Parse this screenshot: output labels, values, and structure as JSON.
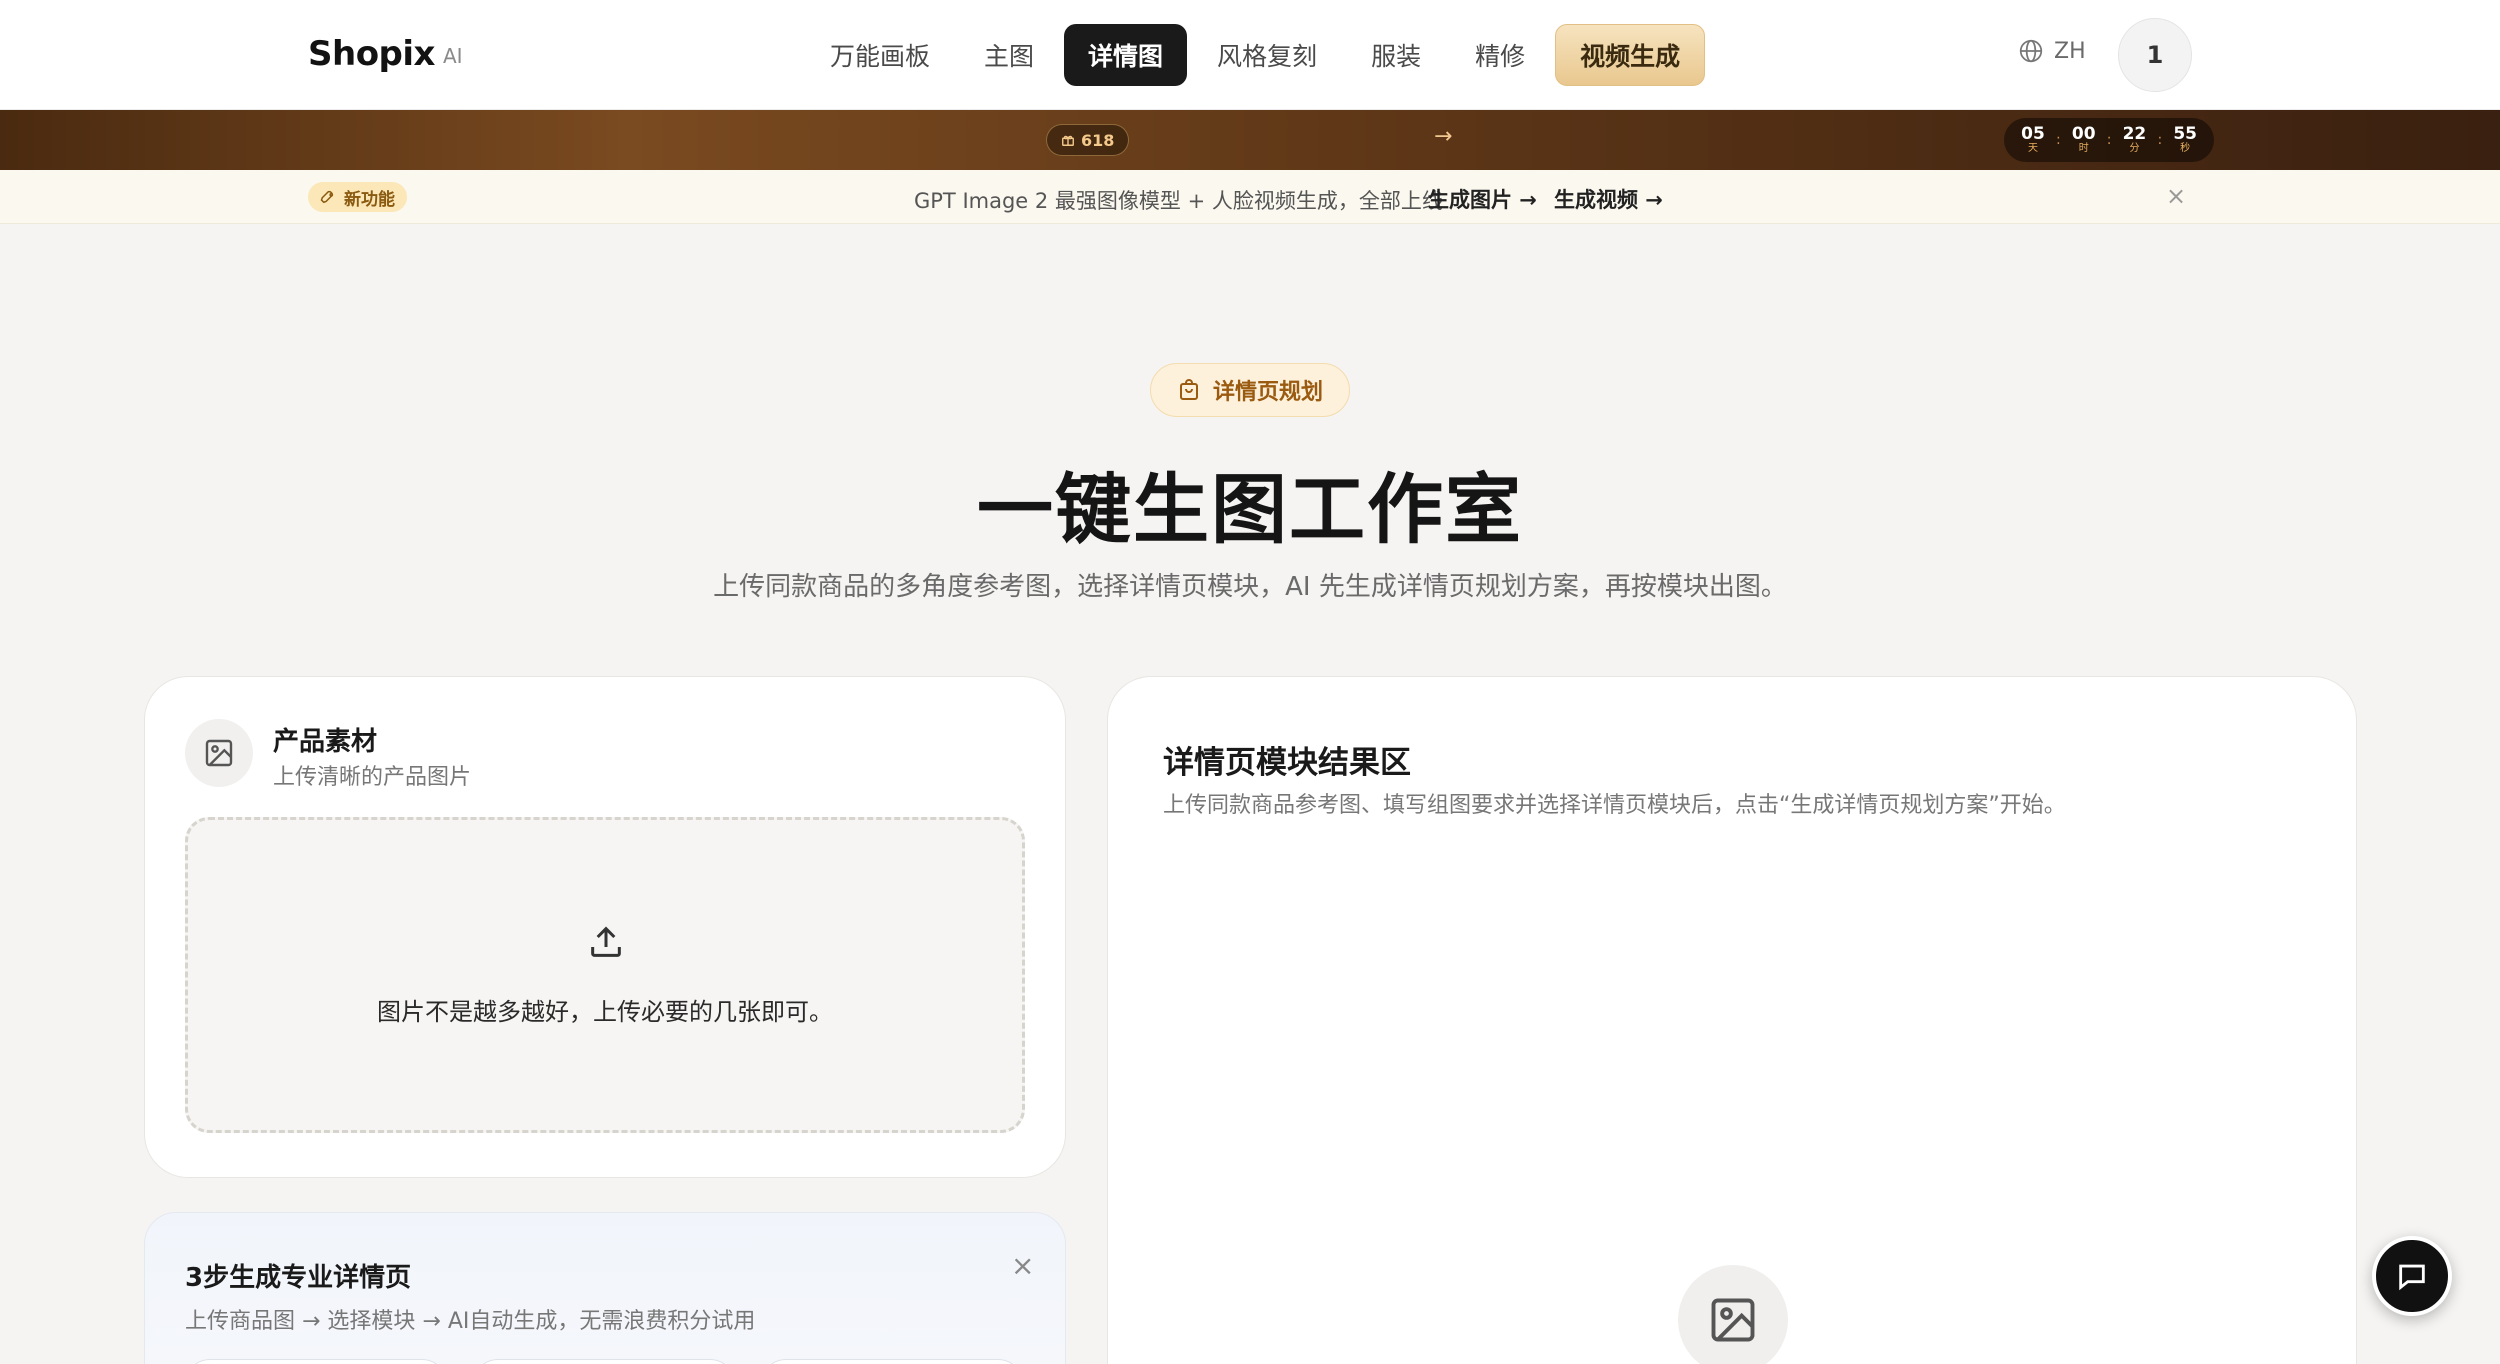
{
  "header": {
    "logo": "Shopix",
    "logo_suffix": "AI",
    "nav": [
      {
        "label": "万能画板"
      },
      {
        "label": "主图"
      },
      {
        "label": "详情图"
      },
      {
        "label": "风格复刻"
      },
      {
        "label": "服装"
      },
      {
        "label": "精修"
      },
      {
        "label": "视频生成"
      }
    ],
    "active_nav": "详情图",
    "language": "ZH",
    "avatar_text": "1"
  },
  "promo": {
    "badge": "618",
    "arrow": "→",
    "countdown": [
      {
        "value": "05",
        "unit": "天"
      },
      {
        "value": "00",
        "unit": "时"
      },
      {
        "value": "22",
        "unit": "分"
      },
      {
        "value": "55",
        "unit": "秒"
      }
    ]
  },
  "announcement": {
    "badge": "新功能",
    "text": "GPT Image 2 最强图像模型 + 人脸视频生成，全部上线",
    "link_image": "生成图片 →",
    "link_video": "生成视频 →",
    "close": "×"
  },
  "hero": {
    "tag": "详情页规划",
    "title": "一键生图工作室",
    "subtitle": "上传同款商品的多角度参考图，选择详情页模块，AI 先生成详情页规划方案，再按模块出图。"
  },
  "upload_card": {
    "title": "产品素材",
    "subtitle": "上传清晰的产品图片",
    "dropzone_text": "图片不是越多越好，上传必要的几张即可。"
  },
  "result_card": {
    "title": "详情页模块结果区",
    "subtitle": "上传同款商品参考图、填写组图要求并选择详情页模块后，点击“生成详情页规划方案”开始。"
  },
  "steps_card": {
    "title": "3步生成专业详情页",
    "subtitle": "上传商品图 → 选择模块 → AI自动生成，无需浪费积分试用",
    "close": "×"
  },
  "colors": {
    "accent_dark": "#1a1a1a",
    "gold": "#e9c88f",
    "tag_text": "#9a5a10"
  }
}
